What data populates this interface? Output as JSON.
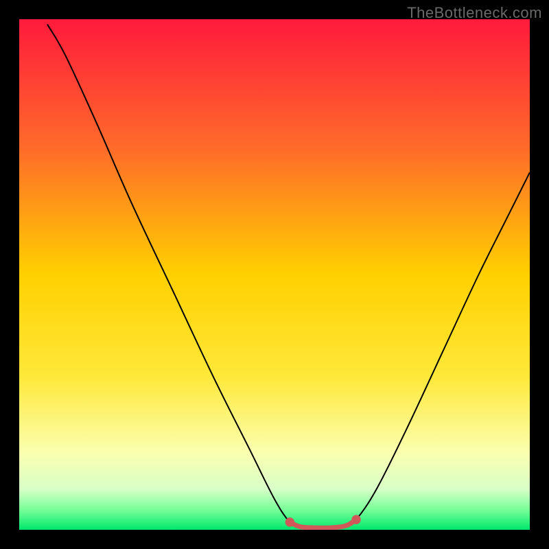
{
  "watermark": "TheBottleneck.com",
  "chart_data": {
    "type": "line",
    "title": "",
    "xlabel": "",
    "ylabel": "",
    "xlim": [
      0,
      100
    ],
    "ylim": [
      0,
      100
    ],
    "background_gradient": {
      "stops": [
        {
          "pos": 0.0,
          "color": "#ff1a3c"
        },
        {
          "pos": 0.25,
          "color": "#ff6a2a"
        },
        {
          "pos": 0.5,
          "color": "#ffd000"
        },
        {
          "pos": 0.7,
          "color": "#ffe83a"
        },
        {
          "pos": 0.85,
          "color": "#faffb0"
        },
        {
          "pos": 0.92,
          "color": "#d8ffc8"
        },
        {
          "pos": 0.96,
          "color": "#7aff9a"
        },
        {
          "pos": 1.0,
          "color": "#00e86c"
        }
      ]
    },
    "series": [
      {
        "name": "bottleneck-curve",
        "stroke": "#000000",
        "stroke_width": 2,
        "points": [
          {
            "x": 5.5,
            "y": 99
          },
          {
            "x": 9,
            "y": 93
          },
          {
            "x": 15,
            "y": 80
          },
          {
            "x": 22,
            "y": 64
          },
          {
            "x": 30,
            "y": 47
          },
          {
            "x": 38,
            "y": 30
          },
          {
            "x": 45,
            "y": 16
          },
          {
            "x": 50,
            "y": 6
          },
          {
            "x": 53,
            "y": 1.5
          },
          {
            "x": 55,
            "y": 0.6
          },
          {
            "x": 60,
            "y": 0.4
          },
          {
            "x": 64,
            "y": 0.8
          },
          {
            "x": 66,
            "y": 2
          },
          {
            "x": 70,
            "y": 8
          },
          {
            "x": 76,
            "y": 20
          },
          {
            "x": 83,
            "y": 35
          },
          {
            "x": 90,
            "y": 50
          },
          {
            "x": 96,
            "y": 62
          },
          {
            "x": 100,
            "y": 70
          }
        ]
      }
    ],
    "highlight": {
      "name": "optimal-zone",
      "stroke": "#d05858",
      "stroke_width": 7,
      "points": [
        {
          "x": 53,
          "y": 1.5
        },
        {
          "x": 55,
          "y": 0.6
        },
        {
          "x": 58,
          "y": 0.4
        },
        {
          "x": 61,
          "y": 0.4
        },
        {
          "x": 64,
          "y": 0.8
        },
        {
          "x": 66,
          "y": 2
        }
      ],
      "endpoints": [
        {
          "x": 53,
          "y": 1.5
        },
        {
          "x": 66,
          "y": 2
        }
      ]
    }
  }
}
